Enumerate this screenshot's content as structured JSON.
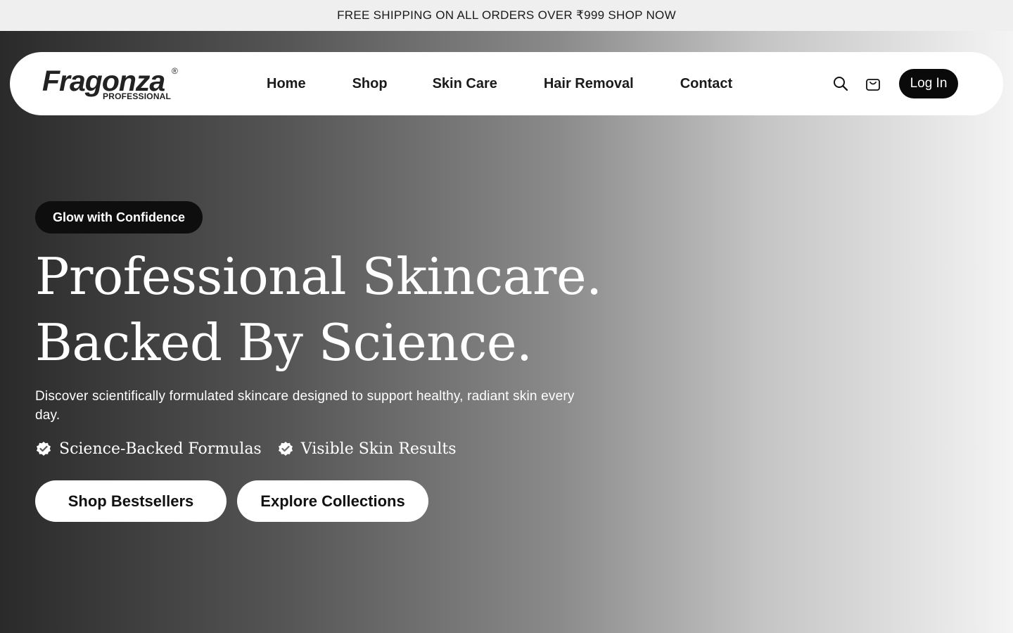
{
  "announcement": "FREE SHIPPING ON ALL ORDERS OVER ₹999 SHOP NOW",
  "brand": {
    "logo_word": "Fragonza",
    "logo_sub": "PROFESSIONAL",
    "reg_mark": "®"
  },
  "nav": {
    "items": [
      {
        "label": "Home"
      },
      {
        "label": "Shop"
      },
      {
        "label": "Skin Care"
      },
      {
        "label": "Hair Removal"
      },
      {
        "label": "Contact"
      }
    ]
  },
  "header_actions": {
    "search_icon": "search-icon",
    "cart_icon": "cart-icon",
    "login_label": "Log In"
  },
  "hero": {
    "tag": "Glow with Confidence",
    "headline_line1": "Professional Skincare.",
    "headline_line2": "Backed By Science.",
    "subtext": "Discover scientifically formulated skincare designed to support healthy, radiant skin every day.",
    "features": [
      {
        "icon": "verified-check-icon",
        "label": "Science-Backed Formulas"
      },
      {
        "icon": "verified-check-icon",
        "label": "Visible Skin Results"
      }
    ],
    "primary_cta": "Shop Bestsellers",
    "secondary_cta": "Explore Collections"
  },
  "colors": {
    "announcement_bg": "#efefef",
    "header_bg": "#ffffff",
    "button_dark": "#0a0a0a",
    "hero_gradient_start": "#2a2a2a",
    "hero_gradient_end": "#f4f4f4"
  }
}
